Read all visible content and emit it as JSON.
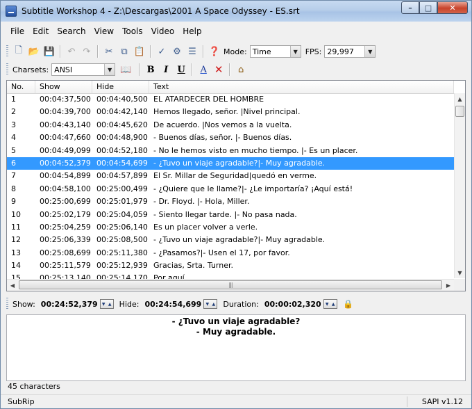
{
  "window": {
    "title": "Subtitle Workshop 4 - Z:\\Descargas\\2001 A Space Odyssey - ES.srt",
    "min_glyph": "–",
    "max_glyph": "□",
    "close_glyph": "✕"
  },
  "menu": [
    "File",
    "Edit",
    "Search",
    "View",
    "Tools",
    "Video",
    "Help"
  ],
  "toolbar": {
    "mode_label": "Mode:",
    "mode_value": "Time",
    "fps_label": "FPS:",
    "fps_value": "29,997",
    "charsets_label": "Charsets:",
    "charsets_value": "ANSI",
    "icons": {
      "new": "🗋",
      "open": "📂",
      "save": "💾",
      "undo": "↶",
      "redo": "↷",
      "cut": "✂",
      "copy": "⧉",
      "paste": "📋",
      "spell": "✓",
      "tools1": "⚙",
      "tools2": "☰",
      "info": "❓",
      "book": "📖",
      "bold": "B",
      "italic": "I",
      "underline": "U",
      "color": "A",
      "clear": "✕",
      "translate": "⌂"
    }
  },
  "list": {
    "columns": [
      "No.",
      "Show",
      "Hide",
      "Text"
    ],
    "rows": [
      {
        "no": "1",
        "show": "00:04:37,500",
        "hide": "00:04:40,500",
        "text": "EL ATARDECER DEL HOMBRE"
      },
      {
        "no": "2",
        "show": "00:04:39,700",
        "hide": "00:04:42,140",
        "text": "Hemos llegado, señor. |Nivel principal."
      },
      {
        "no": "3",
        "show": "00:04:43,140",
        "hide": "00:04:45,620",
        "text": "De acuerdo. |Nos vemos a la vuelta."
      },
      {
        "no": "4",
        "show": "00:04:47,660",
        "hide": "00:04:48,900",
        "text": "- Buenos días, señor. |- Buenos días."
      },
      {
        "no": "5",
        "show": "00:04:49,099",
        "hide": "00:04:52,180",
        "text": "- No le hemos visto en mucho tiempo. |- Es un placer."
      },
      {
        "no": "6",
        "show": "00:04:52,379",
        "hide": "00:04:54,699",
        "text": "- ¿Tuvo un viaje agradable?|- Muy agradable.",
        "selected": true
      },
      {
        "no": "7",
        "show": "00:04:54,899",
        "hide": "00:04:57,899",
        "text": "El Sr. Millar de Seguridad|quedó en verme."
      },
      {
        "no": "8",
        "show": "00:04:58,100",
        "hide": "00:25:00,499",
        "text": "- ¿Quiere que le llame?|- ¿Le importaría? ¡Aquí está!"
      },
      {
        "no": "9",
        "show": "00:25:00,699",
        "hide": "00:25:01,979",
        "text": "- Dr. Floyd. |- Hola, Miller."
      },
      {
        "no": "10",
        "show": "00:25:02,179",
        "hide": "00:25:04,059",
        "text": "- Siento llegar tarde. |- No pasa nada."
      },
      {
        "no": "11",
        "show": "00:25:04,259",
        "hide": "00:25:06,140",
        "text": "Es un placer volver a verle."
      },
      {
        "no": "12",
        "show": "00:25:06,339",
        "hide": "00:25:08,500",
        "text": "- ¿Tuvo un viaje agradable?|- Muy agradable."
      },
      {
        "no": "13",
        "show": "00:25:08,699",
        "hide": "00:25:11,380",
        "text": "- ¿Pasamos?|- Usen el 17, por favor."
      },
      {
        "no": "14",
        "show": "00:25:11,579",
        "hide": "00:25:12,939",
        "text": "Gracias, Srta. Turner."
      },
      {
        "no": "15",
        "show": "00:25:13,140",
        "hide": "00:25:14,170",
        "text": "Por aquí."
      }
    ]
  },
  "timebar": {
    "show_label": "Show:",
    "show_value": "00:24:52,379",
    "hide_label": "Hide:",
    "hide_value": "00:24:54,699",
    "duration_label": "Duration:",
    "duration_value": "00:00:02,320"
  },
  "editor": {
    "line1": "- ¿Tuvo un viaje agradable?",
    "line2": "- Muy agradable."
  },
  "char_count": "45 characters",
  "status": {
    "format": "SubRip",
    "version": "SAPI v1.12"
  }
}
